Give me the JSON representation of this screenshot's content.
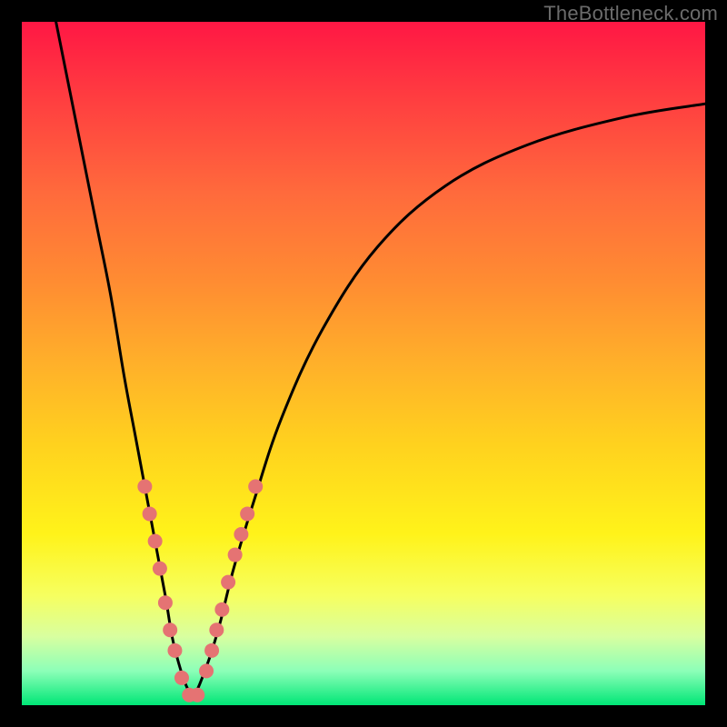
{
  "watermark": {
    "text": "TheBottleneck.com"
  },
  "colors": {
    "frame": "#000000",
    "curve": "#000000",
    "marker": "#e57373",
    "gradient_stops": [
      "#ff1744",
      "#ff4040",
      "#ff6a3c",
      "#ff8c32",
      "#ffb02a",
      "#ffd21e",
      "#fff31a",
      "#f6ff60",
      "#d8ffa0",
      "#8cffb8",
      "#00e676"
    ]
  },
  "chart_data": {
    "type": "line",
    "title": "",
    "xlabel": "",
    "ylabel": "",
    "xlim": [
      0,
      100
    ],
    "ylim": [
      0,
      100
    ],
    "series": [
      {
        "name": "left-branch",
        "x": [
          5,
          7,
          9,
          11,
          13,
          15,
          16.5,
          18,
          19.5,
          21,
          22,
          23,
          24,
          25
        ],
        "y": [
          100,
          90,
          80,
          70,
          60,
          48,
          40,
          32,
          24,
          16,
          10,
          6,
          3,
          1
        ]
      },
      {
        "name": "right-branch",
        "x": [
          25,
          26,
          27.5,
          29,
          31,
          34,
          38,
          44,
          52,
          62,
          74,
          88,
          100
        ],
        "y": [
          1,
          3,
          7,
          12,
          20,
          30,
          42,
          55,
          67,
          76,
          82,
          86,
          88
        ]
      }
    ],
    "markers": [
      {
        "x": 18.0,
        "y": 32
      },
      {
        "x": 18.7,
        "y": 28
      },
      {
        "x": 19.5,
        "y": 24
      },
      {
        "x": 20.2,
        "y": 20
      },
      {
        "x": 21.0,
        "y": 15
      },
      {
        "x": 21.7,
        "y": 11
      },
      {
        "x": 22.4,
        "y": 8
      },
      {
        "x": 23.4,
        "y": 4
      },
      {
        "x": 24.5,
        "y": 1.5
      },
      {
        "x": 25.7,
        "y": 1.5
      },
      {
        "x": 27.0,
        "y": 5
      },
      {
        "x": 27.8,
        "y": 8
      },
      {
        "x": 28.5,
        "y": 11
      },
      {
        "x": 29.3,
        "y": 14
      },
      {
        "x": 30.2,
        "y": 18
      },
      {
        "x": 31.2,
        "y": 22
      },
      {
        "x": 32.1,
        "y": 25
      },
      {
        "x": 33.0,
        "y": 28
      },
      {
        "x": 34.2,
        "y": 32
      }
    ]
  }
}
